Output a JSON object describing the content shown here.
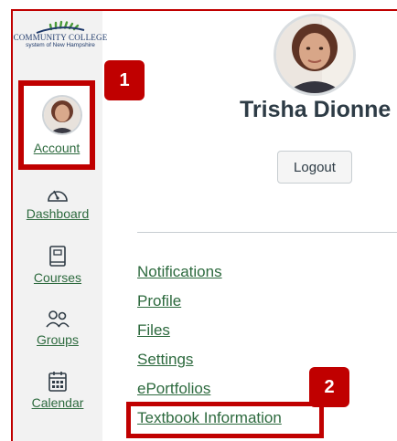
{
  "colors": {
    "highlight": "#c00000",
    "link": "#2d6a3e",
    "nav_icon": "#2f3b45",
    "text": "#2d3b45",
    "sidebar_bg": "#f2f2f2",
    "divider": "#c7cdd1",
    "logo_green": "#4a9a3a",
    "logo_text": "#1f3a6b"
  },
  "logo": {
    "line1": "COMMUNITY COLLEGE",
    "line2": "system of New Hampshire"
  },
  "sidebar": {
    "account_label": "Account",
    "items": [
      {
        "label": "Dashboard",
        "icon": "dashboard-icon"
      },
      {
        "label": "Courses",
        "icon": "courses-icon"
      },
      {
        "label": "Groups",
        "icon": "groups-icon"
      },
      {
        "label": "Calendar",
        "icon": "calendar-icon"
      }
    ]
  },
  "callouts": {
    "one": "1",
    "two": "2"
  },
  "profile": {
    "name": "Trisha Dionne",
    "logout_label": "Logout"
  },
  "menu": {
    "links": [
      "Notifications",
      "Profile",
      "Files",
      "Settings",
      "ePortfolios",
      "Textbook Information"
    ]
  }
}
